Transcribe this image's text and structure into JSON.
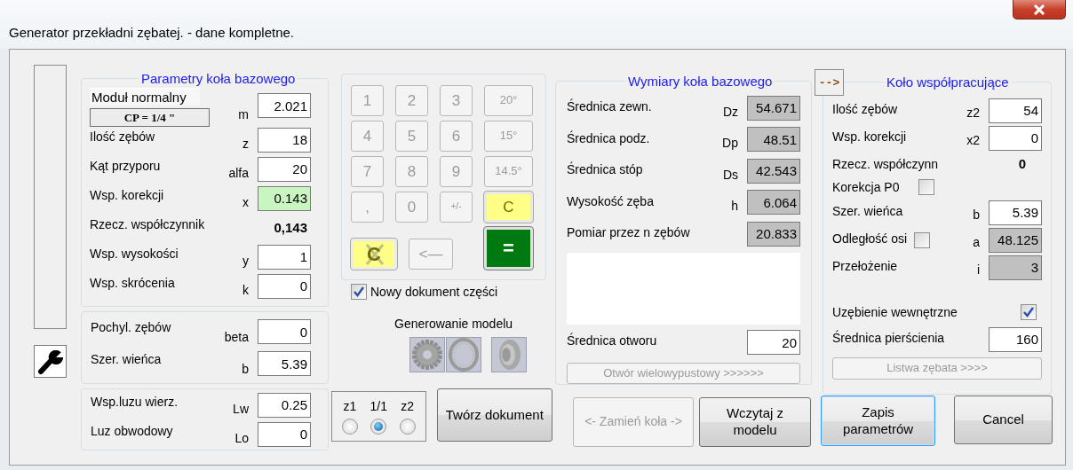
{
  "window": {
    "title": "Generator przekładni zębatej. - dane kompletne."
  },
  "base_params": {
    "title": "Parametry koła bazowego",
    "rows": [
      {
        "kind": "module",
        "label": "Moduł normalny",
        "button": "CP = 1/4 \"",
        "symbol": "m",
        "value": "2.021",
        "highlighted": false
      },
      {
        "kind": "field",
        "label": "Ilość zębów",
        "symbol": "z",
        "value": "18",
        "highlighted": false
      },
      {
        "kind": "field",
        "label": "Kąt przyporu",
        "symbol": "alfa",
        "value": "20",
        "highlighted": false
      },
      {
        "kind": "field",
        "label": "Wsp. korekcji",
        "symbol": "x",
        "value": "0.143",
        "highlighted": true
      },
      {
        "kind": "readout",
        "label": "Rzecz. współczynnik",
        "value": "0,143"
      },
      {
        "kind": "field",
        "label": "Wsp. wysokości",
        "symbol": "y",
        "value": "1",
        "highlighted": false
      },
      {
        "kind": "field",
        "label": "Wsp. skrócenia",
        "symbol": "k",
        "value": "0",
        "highlighted": false
      }
    ]
  },
  "helix": {
    "rows": [
      {
        "kind": "field",
        "label": "Pochyl. zębów",
        "symbol": "beta",
        "value": "0",
        "highlighted": false
      },
      {
        "kind": "field",
        "label": "Szer. wieńca",
        "symbol": "b",
        "value": "5.39",
        "highlighted": false
      }
    ]
  },
  "clearance": {
    "rows": [
      {
        "kind": "field",
        "label": "Wsp.luzu wierz.",
        "symbol": "Lw",
        "value": "0.25",
        "highlighted": false
      },
      {
        "kind": "field",
        "label": "Luz obwodowy",
        "symbol": "Lo",
        "value": "0",
        "highlighted": false
      }
    ]
  },
  "keypad": {
    "keys": [
      {
        "label": "1",
        "kind": "digit",
        "disabled": true
      },
      {
        "label": "2",
        "kind": "digit",
        "disabled": true
      },
      {
        "label": "3",
        "kind": "digit",
        "disabled": true
      },
      {
        "label": "20°",
        "kind": "angle",
        "disabled": true
      },
      {
        "label": "4",
        "kind": "digit",
        "disabled": true
      },
      {
        "label": "5",
        "kind": "digit",
        "disabled": true
      },
      {
        "label": "6",
        "kind": "digit",
        "disabled": true
      },
      {
        "label": "15°",
        "kind": "angle",
        "disabled": true
      },
      {
        "label": "7",
        "kind": "digit",
        "disabled": true
      },
      {
        "label": "8",
        "kind": "digit",
        "disabled": true
      },
      {
        "label": "9",
        "kind": "digit",
        "disabled": true
      },
      {
        "label": "14.5°",
        "kind": "angle",
        "disabled": true
      },
      {
        "label": ",",
        "kind": "digit",
        "disabled": true
      },
      {
        "label": "0",
        "kind": "digit",
        "disabled": true
      },
      {
        "label": "+/-",
        "kind": "sign",
        "disabled": true
      },
      {
        "label": "C",
        "kind": "clear",
        "disabled": false
      },
      {
        "label": "C",
        "kind": "clear-all",
        "disabled": false
      },
      {
        "label": "<—",
        "kind": "backspace",
        "disabled": true
      },
      {
        "label": "=",
        "kind": "equals",
        "disabled": false
      }
    ]
  },
  "new_part_document": {
    "label": "Nowy dokument części",
    "checked": true
  },
  "model_generation": {
    "label": "Generowanie modelu",
    "buttons": [
      {
        "kind": "spur"
      },
      {
        "kind": "ring"
      },
      {
        "kind": "bevel"
      }
    ]
  },
  "wheel_choice": {
    "options": [
      {
        "label": "z1",
        "selected": false
      },
      {
        "label": "1/1",
        "selected": true
      },
      {
        "label": "z2",
        "selected": false
      }
    ]
  },
  "dimensions": {
    "title": "Wymiary koła bazowego",
    "rows": [
      {
        "kind": "output",
        "label": "Średnica zewn.",
        "symbol": "Dz",
        "value": "54.671"
      },
      {
        "kind": "output",
        "label": "Średnica podz.",
        "symbol": "Dp",
        "value": "48.51"
      },
      {
        "kind": "output",
        "label": "Średnica stóp",
        "symbol": "Ds",
        "value": "42.543"
      },
      {
        "kind": "output",
        "label": "Wysokość zęba",
        "symbol": "h",
        "value": "6.064"
      },
      {
        "kind": "output",
        "label": "Pomiar przez n zębów",
        "value": "20.833"
      },
      {
        "kind": "notes"
      },
      {
        "kind": "field",
        "label": "Średnica otworu",
        "value": "20",
        "highlighted": false
      },
      {
        "kind": "button",
        "label": "Otwór wielowypustowy >>>>>>",
        "disabled": true
      }
    ]
  },
  "copy_button": {
    "label": "-->"
  },
  "mating": {
    "title": "Koło współpracujące",
    "rows": [
      {
        "kind": "field",
        "label": "Ilość zębów",
        "symbol": "z2",
        "value": "54",
        "highlighted": false
      },
      {
        "kind": "field",
        "label": "Wsp. korekcji",
        "symbol": "x2",
        "value": "0",
        "highlighted": false
      },
      {
        "kind": "readout",
        "label": "Rzecz. współczynn",
        "value": "0"
      },
      {
        "kind": "checkbox",
        "label": "Korekcja P0",
        "checked": false
      },
      {
        "kind": "field",
        "label": "Szer. wieńca",
        "symbol": "b",
        "value": "5.39",
        "highlighted": false
      },
      {
        "kind": "checkbox-output",
        "label": "Odległość osi",
        "checked": false,
        "symbol": "a",
        "value": "48.125"
      },
      {
        "kind": "output",
        "label": "Przełożenie",
        "symbol": "i",
        "value": "3"
      },
      {
        "kind": "option",
        "label": "Uzębienie wewnętrzne",
        "checked": true
      },
      {
        "kind": "field",
        "label": "Średnica pierścienia",
        "value": "160",
        "highlighted": false
      },
      {
        "kind": "button",
        "label": "Listwa zębata >>>>",
        "disabled": true
      }
    ]
  },
  "buttons": [
    {
      "label": "Twórz dokument",
      "disabled": false,
      "default": false
    },
    {
      "label": "<- Zamień koła ->",
      "disabled": true,
      "default": false
    },
    {
      "label": "Wczytaj z modelu",
      "disabled": false,
      "default": false
    },
    {
      "label": "Zapis parametrów",
      "disabled": false,
      "default": true
    },
    {
      "label": "Cancel",
      "disabled": false,
      "default": false
    }
  ]
}
